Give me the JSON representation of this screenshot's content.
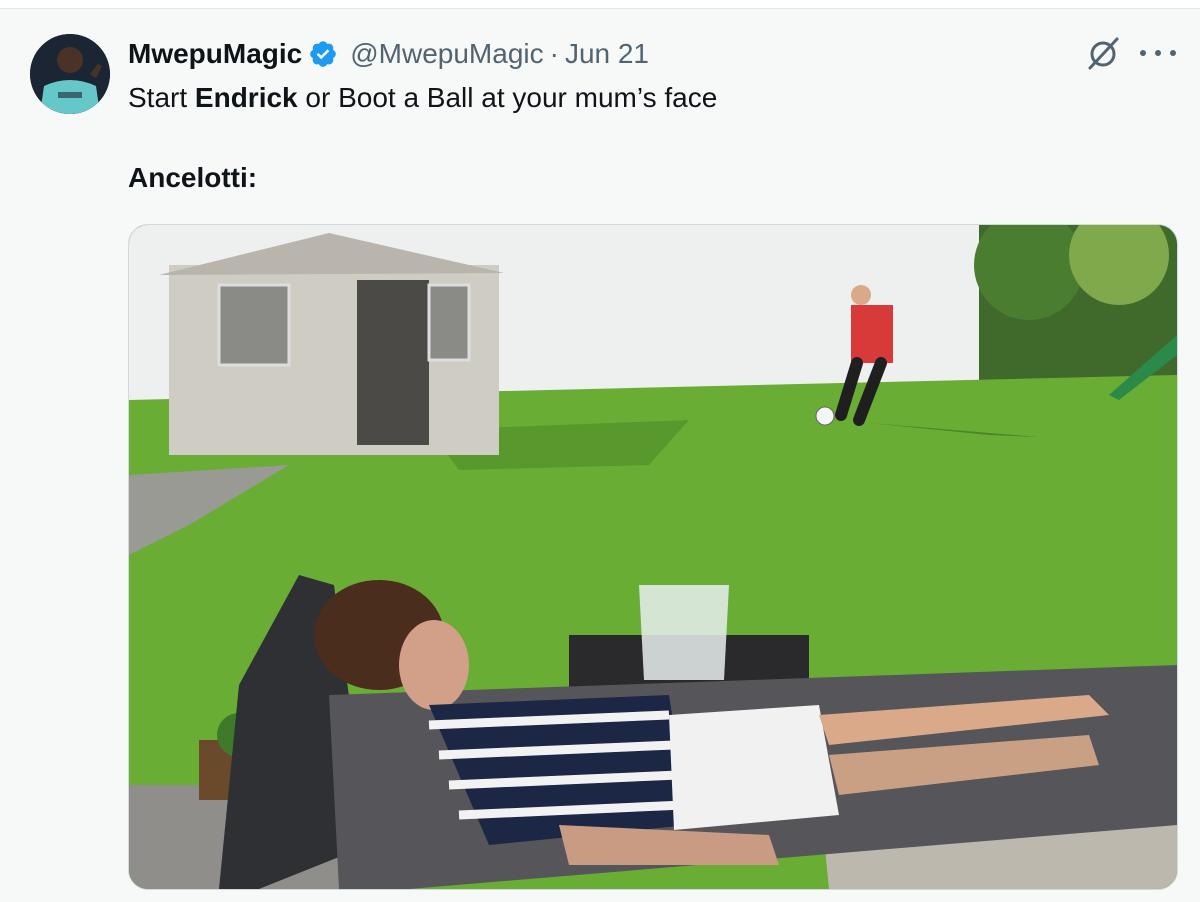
{
  "tweet": {
    "author_name": "MwepuMagic",
    "handle": "@MwepuMagic",
    "separator": "·",
    "date": "Jun 21",
    "text_line1_pre": "Start ",
    "text_line1_bold": "Endrick",
    "text_line1_post": " or Boot a Ball at your mum’s face",
    "text_line2": "Ancelotti:"
  },
  "icons": {
    "verified": "verified-badge-icon",
    "grok": "grok-icon",
    "more": "more-options-icon"
  },
  "colors": {
    "verified_blue": "#1d9bf0",
    "secondary_text": "#536471",
    "primary_text": "#0f1419"
  }
}
